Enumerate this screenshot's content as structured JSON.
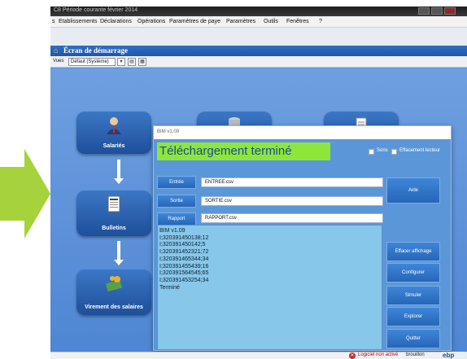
{
  "window": {
    "title": "C8  Période courante février 2014",
    "header_title": "Écran de démarrage"
  },
  "menu": [
    "s",
    "Etablissements",
    "Déclarations",
    "Opérations",
    "Paramètres de paye",
    "Paramètres",
    "Outils",
    "Fenêtres",
    "?"
  ],
  "views": {
    "label": "Vues",
    "selected": "Défaut (Système)"
  },
  "tiles": {
    "salaries": "Salariés",
    "bulletins": "Bulletins",
    "virement": "Virement des salaires"
  },
  "bim": {
    "title": "BIM v1.09",
    "status_banner": "Téléchargement terminé",
    "checkbox_sons": "Sons",
    "checkbox_effacement": "Effacement lecteur",
    "btn_entree": "Entrée",
    "btn_sortie": "Sortie",
    "btn_rapport": "Rapport",
    "entree_value": "ENTREE.csv",
    "sortie_value": "SORTIE.csv",
    "rapport_value": "RAPPORT.csv",
    "btn_aide": "Aide",
    "btn_effacer": "Effacer affichage",
    "btn_configurer": "Configurer",
    "btn_simuler": "Simuler",
    "btn_explorer": "Explorer",
    "btn_quitter": "Quitter",
    "log": [
      "BIM v1.09",
      "I;320391450138;12",
      "I;320391450142;5",
      "I;320391452321;72",
      "I;320391465344;34",
      "I;320391455439;16",
      "I;320391564545;65",
      "I;320391453254;34",
      "Terminé"
    ]
  },
  "status": {
    "logiciel": "Logiciel non activé",
    "brouillon": "brouillon",
    "logo": "ebp"
  },
  "colors": {
    "accent_arrow": "#a6d23c",
    "banner": "#8fe63a",
    "work_bg": "#5a8fd4"
  }
}
